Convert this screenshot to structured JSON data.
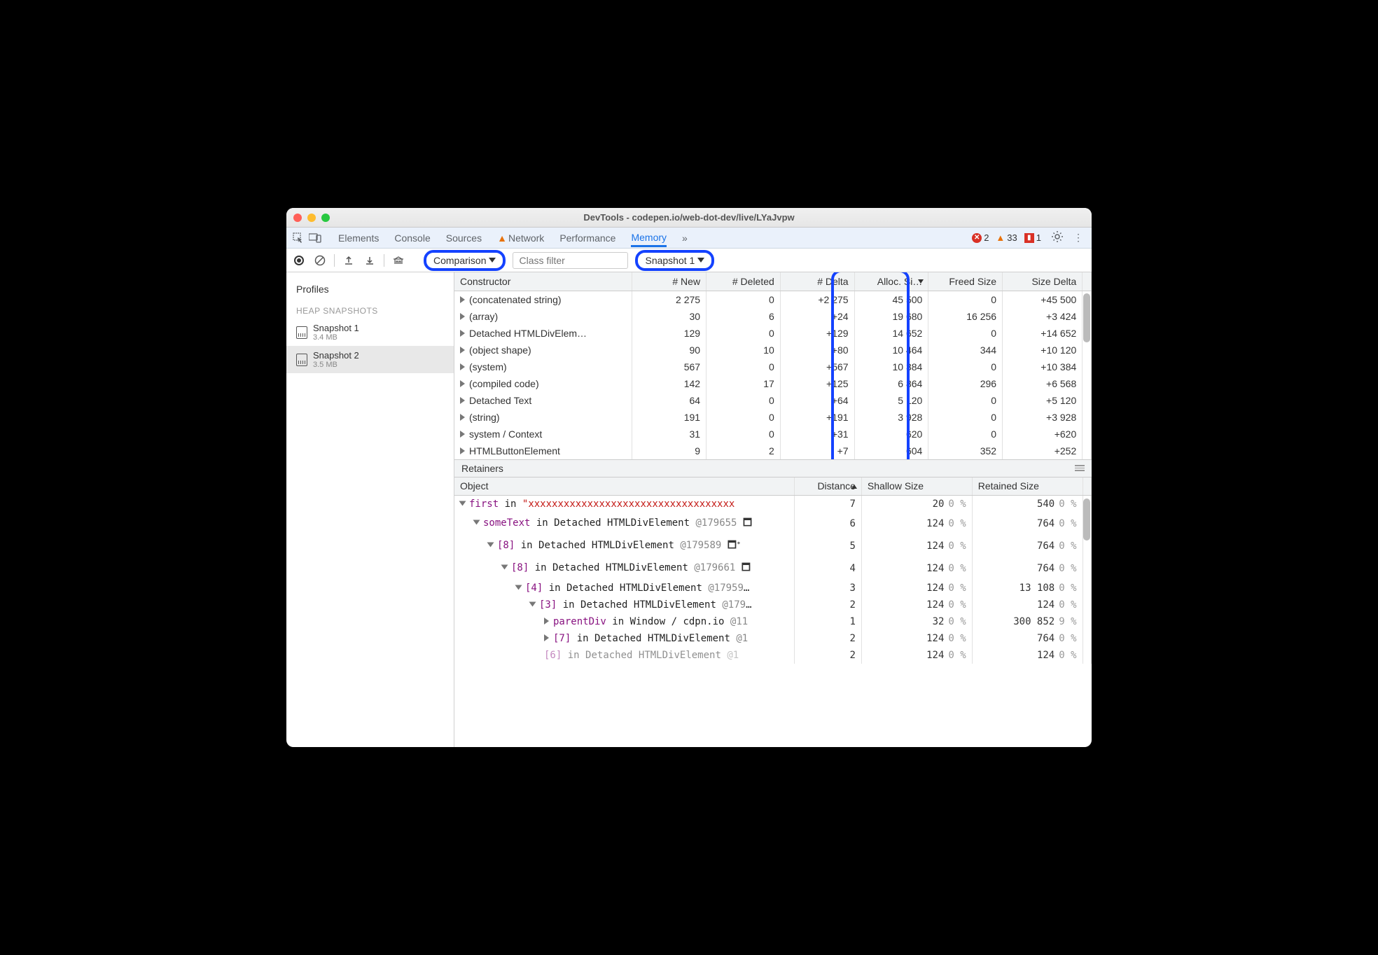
{
  "title": "DevTools - codepen.io/web-dot-dev/live/LYaJvpw",
  "tabs": [
    "Elements",
    "Console",
    "Sources",
    "Network",
    "Performance",
    "Memory"
  ],
  "active_tab": "Memory",
  "status": {
    "errors": "2",
    "warnings": "33",
    "issues": "1"
  },
  "toolbar": {
    "mode": "Comparison",
    "filter_placeholder": "Class filter",
    "baseline": "Snapshot 1"
  },
  "sidebar": {
    "title": "Profiles",
    "section": "HEAP SNAPSHOTS",
    "items": [
      {
        "name": "Snapshot 1",
        "size": "3.4 MB"
      },
      {
        "name": "Snapshot 2",
        "size": "3.5 MB"
      }
    ]
  },
  "headers": [
    "Constructor",
    "# New",
    "# Deleted",
    "# Delta",
    "Alloc. Si…",
    "Freed Size",
    "Size Delta"
  ],
  "rows": [
    {
      "c": "(concatenated string)",
      "new": "2 275",
      "del": "0",
      "delta": "+2 275",
      "alloc": "45 500",
      "freed": "0",
      "sd": "+45 500"
    },
    {
      "c": "(array)",
      "new": "30",
      "del": "6",
      "delta": "+24",
      "alloc": "19 680",
      "freed": "16 256",
      "sd": "+3 424"
    },
    {
      "c": "Detached HTMLDivElem…",
      "new": "129",
      "del": "0",
      "delta": "+129",
      "alloc": "14 652",
      "freed": "0",
      "sd": "+14 652"
    },
    {
      "c": "(object shape)",
      "new": "90",
      "del": "10",
      "delta": "+80",
      "alloc": "10 464",
      "freed": "344",
      "sd": "+10 120"
    },
    {
      "c": "(system)",
      "new": "567",
      "del": "0",
      "delta": "+567",
      "alloc": "10 384",
      "freed": "0",
      "sd": "+10 384"
    },
    {
      "c": "(compiled code)",
      "new": "142",
      "del": "17",
      "delta": "+125",
      "alloc": "6 864",
      "freed": "296",
      "sd": "+6 568"
    },
    {
      "c": "Detached Text",
      "new": "64",
      "del": "0",
      "delta": "+64",
      "alloc": "5 120",
      "freed": "0",
      "sd": "+5 120"
    },
    {
      "c": "(string)",
      "new": "191",
      "del": "0",
      "delta": "+191",
      "alloc": "3 928",
      "freed": "0",
      "sd": "+3 928"
    },
    {
      "c": "system / Context",
      "new": "31",
      "del": "0",
      "delta": "+31",
      "alloc": "620",
      "freed": "0",
      "sd": "+620"
    },
    {
      "c": "HTMLButtonElement",
      "new": "9",
      "del": "2",
      "delta": "+7",
      "alloc": "604",
      "freed": "352",
      "sd": "+252"
    }
  ],
  "retainers_title": "Retainers",
  "ret_headers": [
    "Object",
    "Distance",
    "Shallow Size",
    "Retained Size"
  ],
  "ret_rows": [
    {
      "depth": 0,
      "open": true,
      "html": "<span class='k-prop'>first</span> <span class='k-in'>in</span> <span class='k-str'>\"xxxxxxxxxxxxxxxxxxxxxxxxxxxxxxxxxxx</span>",
      "dist": "7",
      "sh": "20",
      "shp": "0 %",
      "ret": "540",
      "retp": "0 %"
    },
    {
      "depth": 1,
      "open": true,
      "html": "<span class='k-prop'>someText</span> <span class='k-in'>in</span> <span class='k-type'>Detached HTMLDivElement</span> <span class='k-id'>@179655</span> 🗖",
      "dist": "6",
      "sh": "124",
      "shp": "0 %",
      "ret": "764",
      "retp": "0 %"
    },
    {
      "depth": 2,
      "open": true,
      "html": "<span class='k-idx'>[8]</span> <span class='k-in'>in</span> <span class='k-type'>Detached HTMLDivElement</span> <span class='k-id'>@179589</span> 🗖ᐩ",
      "dist": "5",
      "sh": "124",
      "shp": "0 %",
      "ret": "764",
      "retp": "0 %"
    },
    {
      "depth": 3,
      "open": true,
      "html": "<span class='k-idx'>[8]</span> <span class='k-in'>in</span> <span class='k-type'>Detached HTMLDivElement</span> <span class='k-id'>@179661</span> 🗖",
      "dist": "4",
      "sh": "124",
      "shp": "0 %",
      "ret": "764",
      "retp": "0 %"
    },
    {
      "depth": 4,
      "open": true,
      "html": "<span class='k-idx'>[4]</span> <span class='k-in'>in</span> <span class='k-type'>Detached HTMLDivElement</span> <span class='k-id'>@17959</span>…",
      "dist": "3",
      "sh": "124",
      "shp": "0 %",
      "ret": "13 108",
      "retp": "0 %"
    },
    {
      "depth": 5,
      "open": true,
      "html": "<span class='k-idx'>[3]</span> <span class='k-in'>in</span> <span class='k-type'>Detached HTMLDivElement</span> <span class='k-id'>@179</span>…",
      "dist": "2",
      "sh": "124",
      "shp": "0 %",
      "ret": "124",
      "retp": "0 %"
    },
    {
      "depth": 6,
      "open": false,
      "html": "<span class='k-prop'>parentDiv</span> <span class='k-in'>in</span> <span class='k-type'>Window / cdpn.io</span> <span class='k-id'>@11</span>",
      "dist": "1",
      "sh": "32",
      "shp": "0 %",
      "ret": "300 852",
      "retp": "9 %"
    },
    {
      "depth": 6,
      "open": false,
      "html": "<span class='k-idx'>[7]</span> <span class='k-in'>in</span> <span class='k-type'>Detached HTMLDivElement</span> <span class='k-id'>@1</span>",
      "dist": "2",
      "sh": "124",
      "shp": "0 %",
      "ret": "764",
      "retp": "0 %"
    },
    {
      "depth": 6,
      "open": null,
      "html": "<span class='k-idx' style='opacity:.5'>[6]</span> <span class='k-in' style='opacity:.5'>in</span> <span class='k-type' style='opacity:.5'>Detached HTMLDivElement</span> <span class='k-id' style='opacity:.5'>@1</span>",
      "dist": "2",
      "sh": "124",
      "shp": "0 %",
      "ret": "124",
      "retp": "0 %"
    }
  ]
}
